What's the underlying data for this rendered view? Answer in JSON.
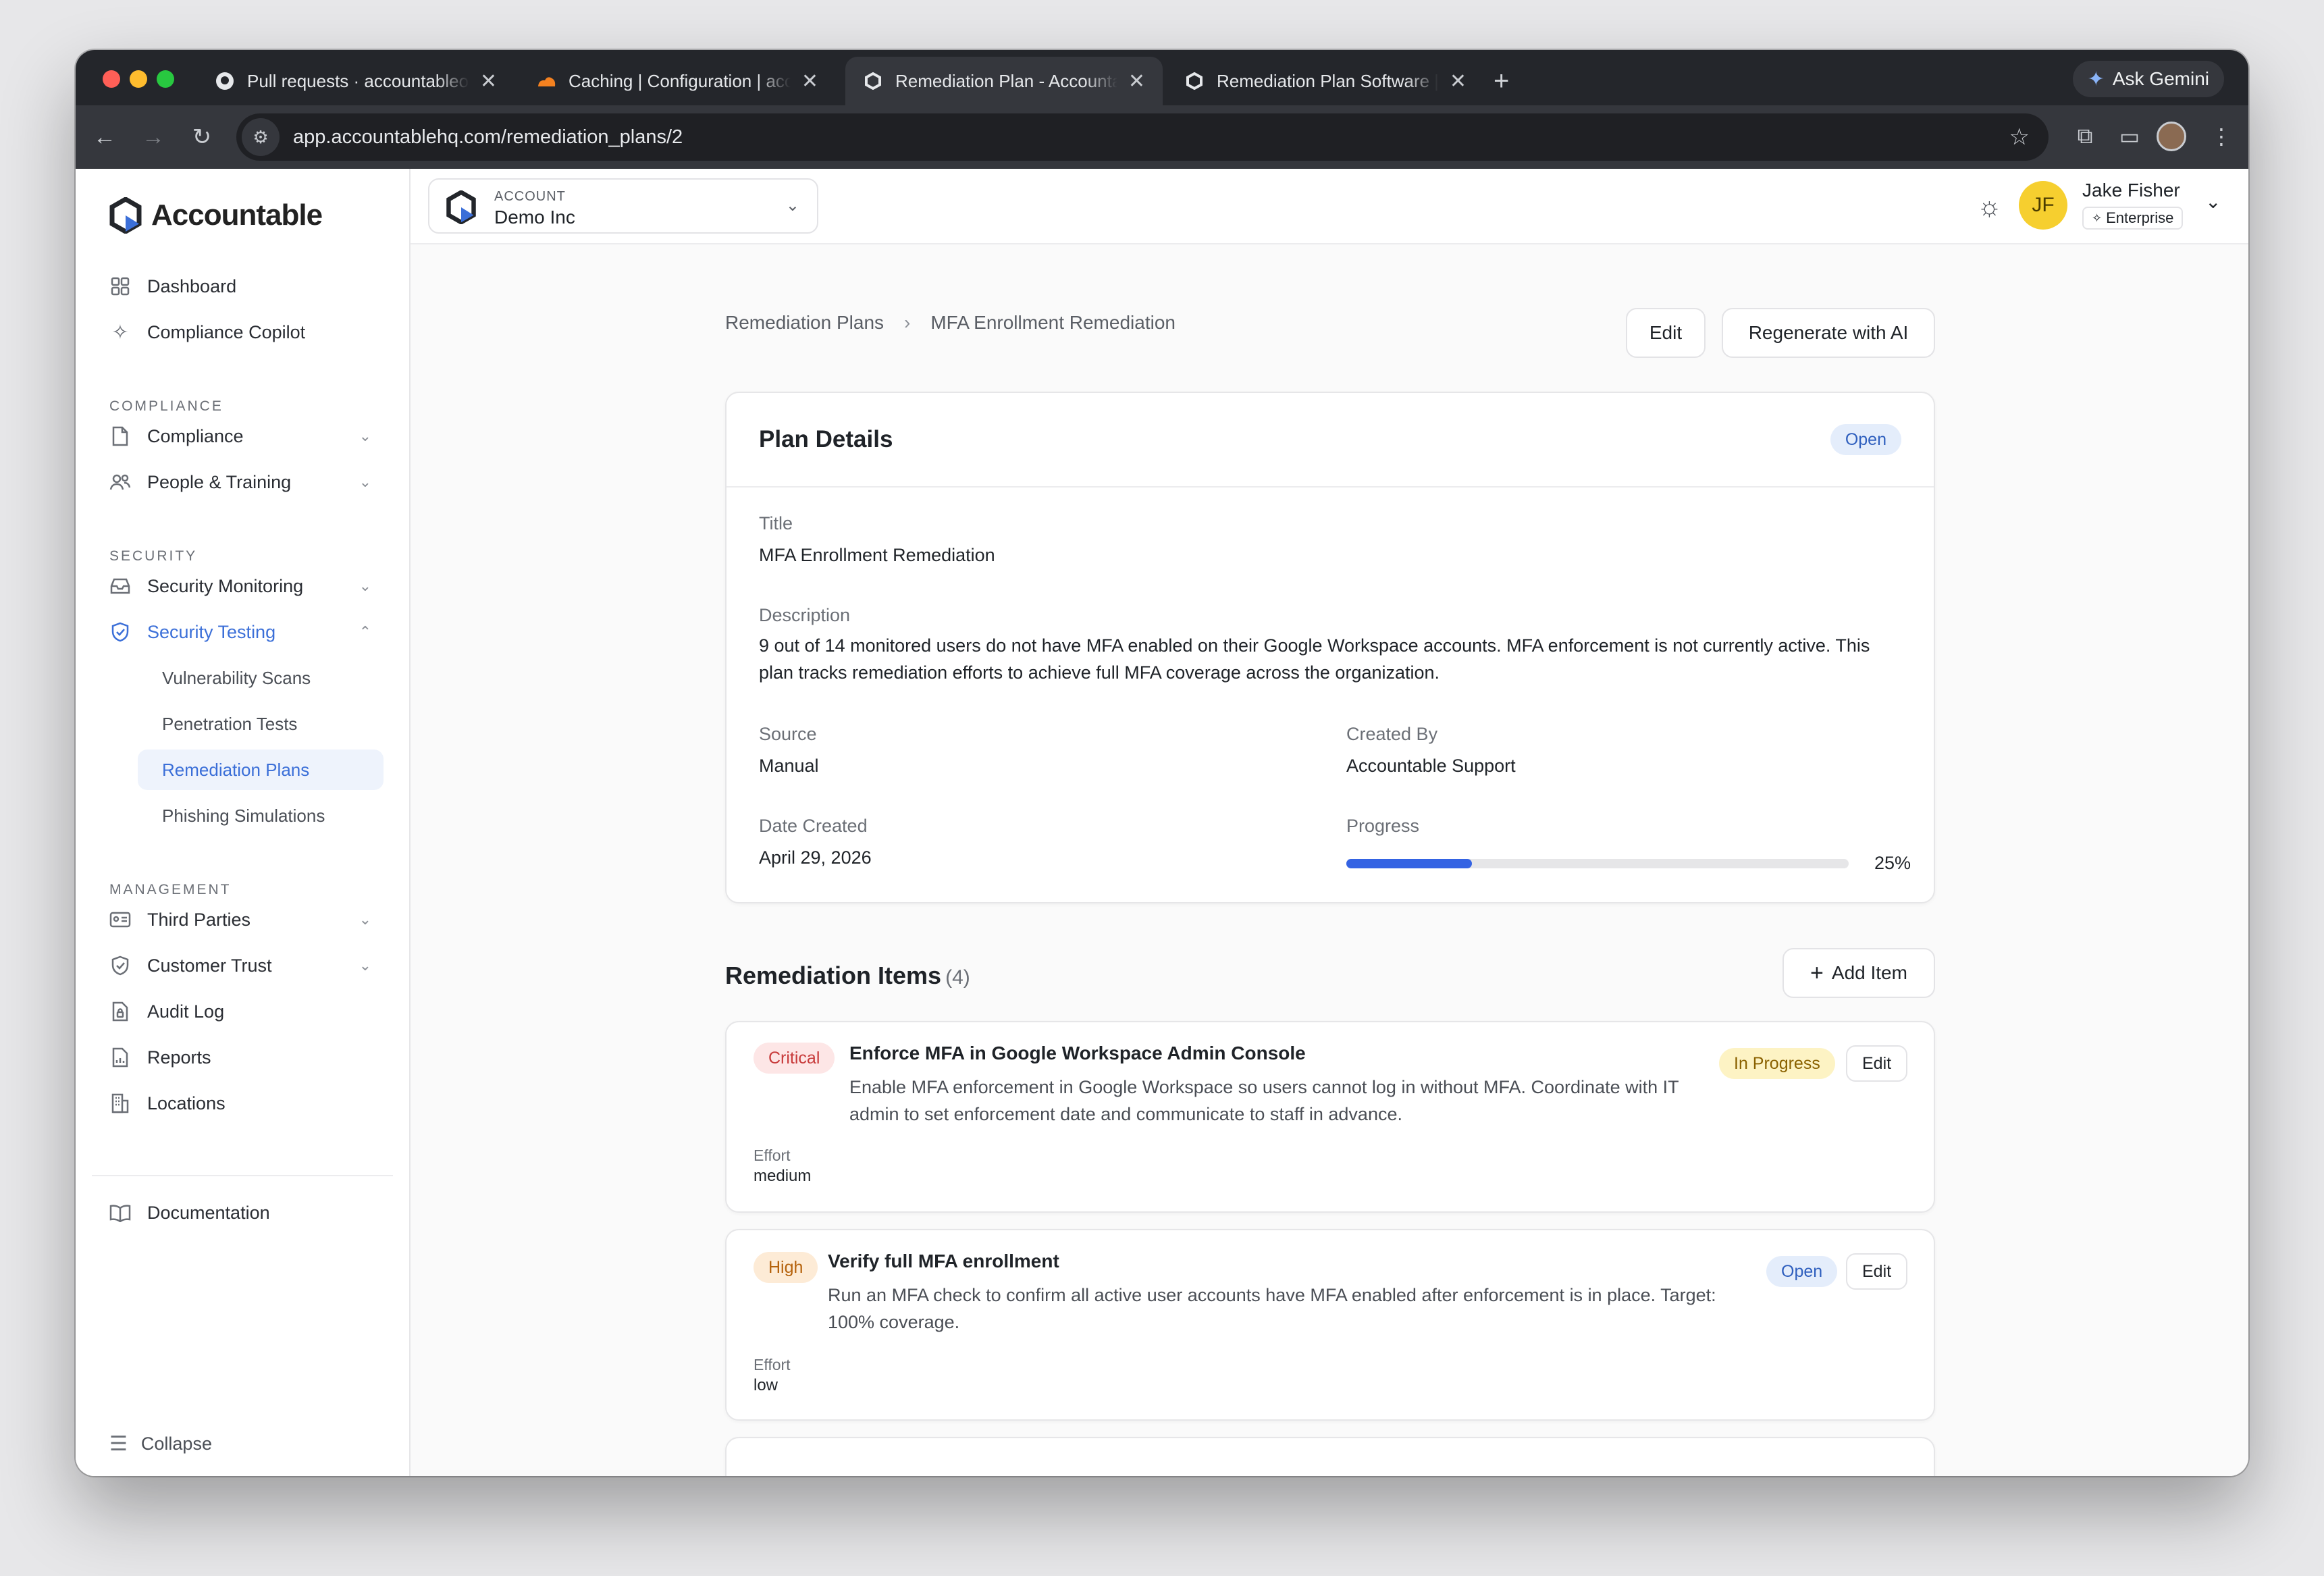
{
  "browser": {
    "tabs": [
      {
        "title": "Pull requests · accountableorg"
      },
      {
        "title": "Caching | Configuration | acco"
      },
      {
        "title": "Remediation Plan - Accountable"
      },
      {
        "title": "Remediation Plan Software | A"
      }
    ],
    "gemini_label": "Ask Gemini",
    "url": "app.accountablehq.com/remediation_plans/2"
  },
  "sidebar": {
    "brand": "Accountable",
    "top_items": [
      {
        "label": "Dashboard"
      },
      {
        "label": "Compliance Copilot"
      }
    ],
    "compliance_section": "COMPLIANCE",
    "compliance_items": [
      {
        "label": "Compliance"
      },
      {
        "label": "People & Training"
      }
    ],
    "security_section": "SECURITY",
    "security_items": [
      {
        "label": "Security Monitoring"
      },
      {
        "label": "Security Testing"
      }
    ],
    "security_sub_items": [
      {
        "label": "Vulnerability Scans"
      },
      {
        "label": "Penetration Tests"
      },
      {
        "label": "Remediation Plans"
      },
      {
        "label": "Phishing Simulations"
      }
    ],
    "management_section": "MANAGEMENT",
    "management_items": [
      {
        "label": "Third Parties"
      },
      {
        "label": "Customer Trust"
      },
      {
        "label": "Audit Log"
      },
      {
        "label": "Reports"
      },
      {
        "label": "Locations"
      }
    ],
    "documentation": "Documentation",
    "collapse": "Collapse"
  },
  "topbar": {
    "account_label": "ACCOUNT",
    "account_value": "Demo Inc",
    "user_initials": "JF",
    "user_name": "Jake Fisher",
    "user_plan": "Enterprise"
  },
  "breadcrumb": {
    "parent": "Remediation Plans",
    "current": "MFA Enrollment Remediation"
  },
  "actions": {
    "edit": "Edit",
    "regenerate": "Regenerate with AI"
  },
  "plan": {
    "heading": "Plan Details",
    "status": "Open",
    "title_label": "Title",
    "title_value": "MFA Enrollment Remediation",
    "description_label": "Description",
    "description_value": "9 out of 14 monitored users do not have MFA enabled on their Google Workspace accounts. MFA enforcement is not currently active. This plan tracks remediation efforts to achieve full MFA coverage across the organization.",
    "source_label": "Source",
    "source_value": "Manual",
    "created_by_label": "Created By",
    "created_by_value": "Accountable Support",
    "date_label": "Date Created",
    "date_value": "April 29, 2026",
    "progress_label": "Progress",
    "progress_text": "25%",
    "progress_fraction": 0.25
  },
  "items_section": {
    "heading": "Remediation Items",
    "count": "(4)",
    "add_label": "Add Item",
    "items": [
      {
        "priority": "Critical",
        "title": "Enforce MFA in Google Workspace Admin Console",
        "description": "Enable MFA enforcement in Google Workspace so users cannot log in without MFA. Coordinate with IT admin to set enforcement date and communicate to staff in advance.",
        "status": "In Progress",
        "edit": "Edit",
        "effort_label": "Effort",
        "effort": "medium"
      },
      {
        "priority": "High",
        "title": "Verify full MFA enrollment",
        "description": "Run an MFA check to confirm all active user accounts have MFA enabled after enforcement is in place. Target: 100% coverage.",
        "status": "Open",
        "edit": "Edit",
        "effort_label": "Effort",
        "effort": "low"
      }
    ]
  },
  "colors": {
    "accent": "#3b6fd8",
    "progress_fill": "#3463e3",
    "avatar": "#f6cf2f"
  }
}
